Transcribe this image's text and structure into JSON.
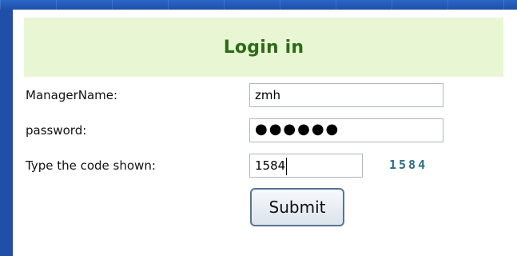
{
  "form": {
    "title": "Login in",
    "fields": {
      "manager_name": {
        "label": "ManagerName:",
        "value": "zmh"
      },
      "password": {
        "label": "password:",
        "value": "●●●●●●"
      },
      "code": {
        "label": "Type the code shown:",
        "value": "1584",
        "captcha_text": "1584"
      }
    },
    "submit_label": "Submit"
  }
}
